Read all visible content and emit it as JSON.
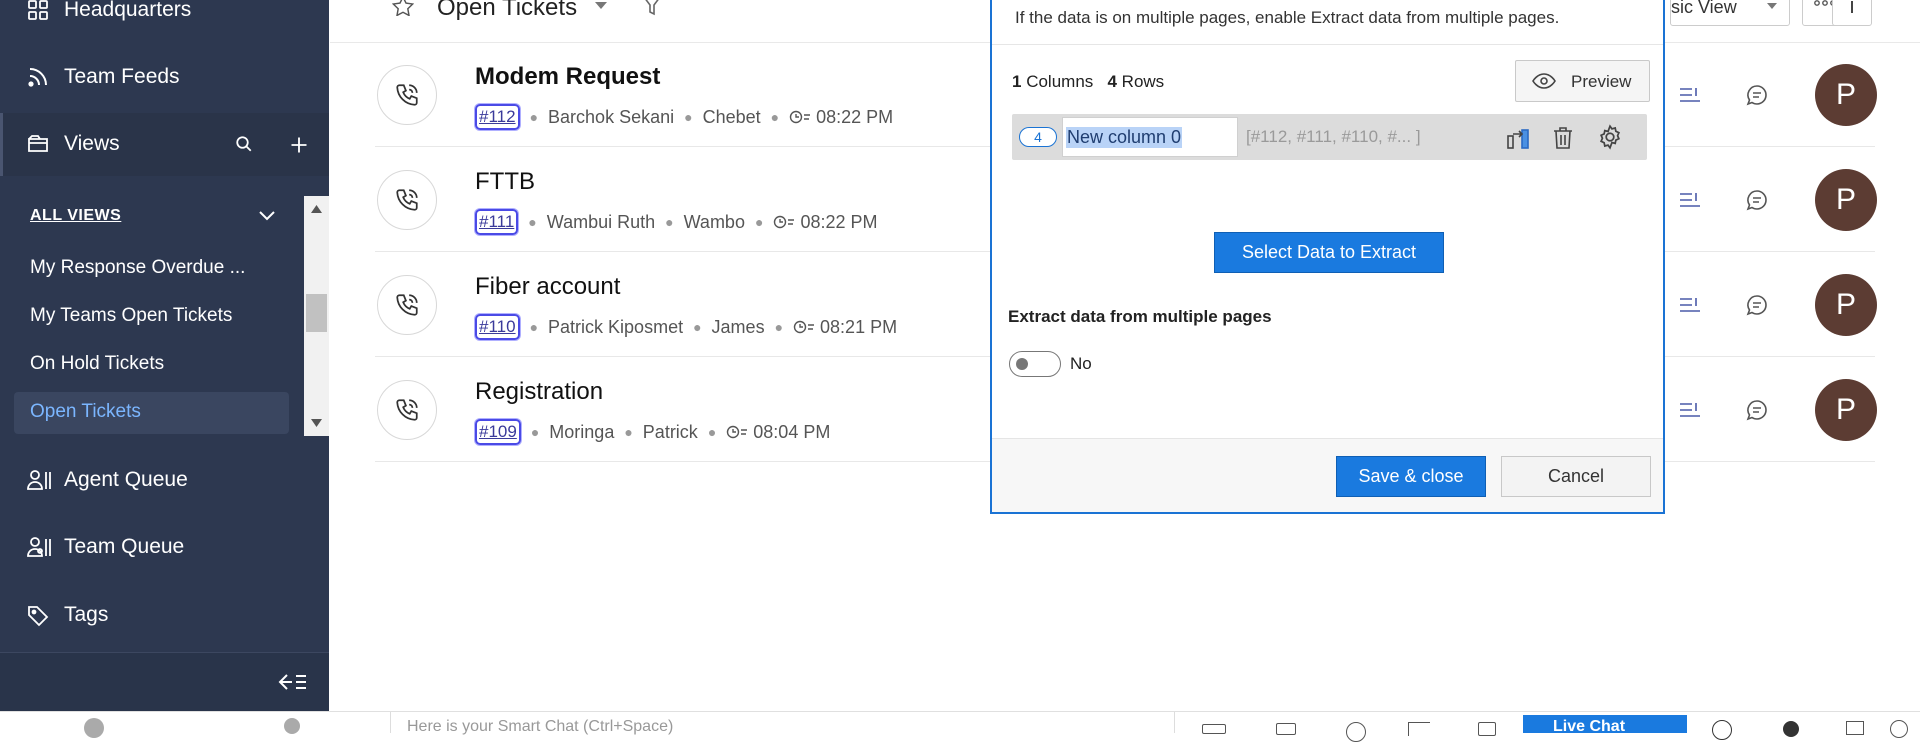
{
  "sidebar": {
    "headquarters": "Headquarters",
    "team_feeds": "Team Feeds",
    "views": "Views",
    "all_views": "ALL VIEWS",
    "sub_items": [
      "My Response Overdue ...",
      "My Teams Open Tickets",
      "On Hold Tickets",
      "Open Tickets"
    ],
    "agent_queue": "Agent Queue",
    "team_queue": "Team Queue",
    "tags": "Tags"
  },
  "topbar": {
    "view_title": "Open Tickets",
    "view_mode": "sic View"
  },
  "tickets": [
    {
      "title": "Modem Request",
      "id": "#112",
      "contact": "Barchok Sekani",
      "account": "Chebet",
      "time": "08:22 PM",
      "avatar": "P"
    },
    {
      "title": "FTTB",
      "id": "#111",
      "contact": "Wambui Ruth",
      "account": "Wambo",
      "time": "08:22 PM",
      "avatar": "P"
    },
    {
      "title": "Fiber account",
      "id": "#110",
      "contact": "Patrick Kiposmet",
      "account": "James",
      "time": "08:21 PM",
      "avatar": "P"
    },
    {
      "title": "Registration",
      "id": "#109",
      "contact": "Moringa",
      "account": "Patrick",
      "time": "08:04 PM",
      "avatar": "P"
    }
  ],
  "dialog": {
    "hint": "If the data is on multiple pages, enable Extract data from multiple pages.",
    "columns_count": "1",
    "columns_label": "Columns",
    "rows_count": "4",
    "rows_label": "Rows",
    "preview": "Preview",
    "column_badge": "4",
    "column_name": "New column 0",
    "column_sample": "[#112, #111, #110, #... ]",
    "select_button": "Select Data to Extract",
    "multi_pages_label": "Extract data from multiple pages",
    "toggle_state": "No",
    "save_close": "Save & close",
    "cancel": "Cancel"
  },
  "bottom": {
    "smart_chat_placeholder": "Here is your Smart Chat (Ctrl+Space)",
    "live_chat": "Live Chat"
  },
  "colors": {
    "sidebar_bg": "#2d3850",
    "accent": "#1a7adf",
    "active_view": "#7bb6ff",
    "avatar": "#5c3c33"
  }
}
